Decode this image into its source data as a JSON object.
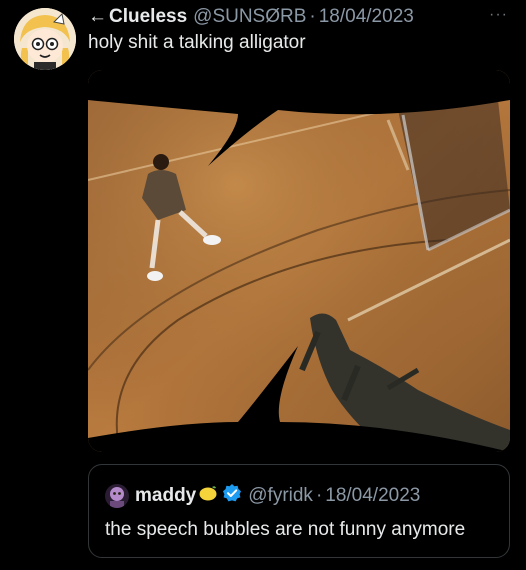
{
  "tweet": {
    "back_arrow": "←",
    "author_name": "Clueless",
    "author_handle": "@SUNSØRB",
    "separator": "·",
    "date": "18/04/2023",
    "more": "···",
    "text": "holy shit a talking alligator"
  },
  "quoted": {
    "author_name": "maddy",
    "author_handle": "@fyridk",
    "separator": "·",
    "date": "18/04/2023",
    "text": "the speech bubbles are not funny anymore"
  },
  "icons": {
    "back": "arrow-left-icon",
    "more": "more-horizontal-icon",
    "verified": "verified-badge-icon",
    "emoji": "lemon-icon"
  },
  "colors": {
    "background": "#000000",
    "text_primary": "#e7e9ea",
    "text_secondary": "#8b98a5",
    "verified": "#1d9bf0",
    "border": "#333639"
  }
}
